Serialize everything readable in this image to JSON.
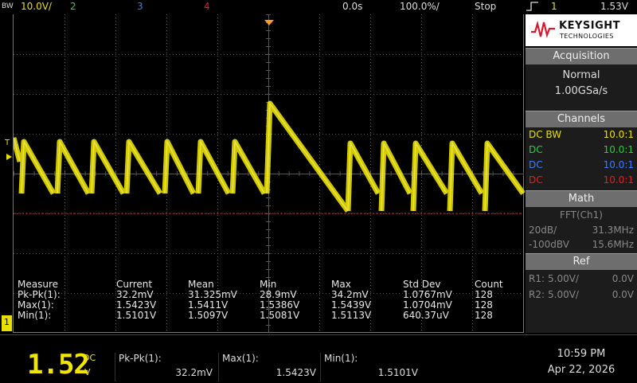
{
  "topbar": {
    "bw": "BW",
    "ch1_scale": "10.0V/",
    "ch2": "2",
    "ch3": "3",
    "ch4": "4",
    "time_offset": "0.0s",
    "time_scale": "100.0%/",
    "run_state": "Stop",
    "trig_channel": "1",
    "trig_level": "1.53V"
  },
  "scope": {
    "trigger_marker": "T",
    "channel_marker": "1"
  },
  "colors": {
    "ch1": "#e8e000",
    "ch2": "#2ecc40",
    "ch3": "#3a7bff",
    "ch4": "#e02020",
    "grid": "#555555",
    "panel_header": "#6e6e6e"
  },
  "measure": {
    "headers": [
      "Measure",
      "Current",
      "Mean",
      "Min",
      "Max",
      "Std Dev",
      "Count"
    ],
    "rows": [
      [
        "Pk-Pk(1):",
        "32.2mV",
        "31.325mV",
        "28.9mV",
        "34.2mV",
        "1.0767mV",
        "128"
      ],
      [
        "Max(1):",
        "1.5423V",
        "1.5411V",
        "1.5386V",
        "1.5439V",
        "1.0704mV",
        "128"
      ],
      [
        "Min(1):",
        "1.5101V",
        "1.5097V",
        "1.5081V",
        "1.5113V",
        "640.37uV",
        "128"
      ]
    ]
  },
  "panel": {
    "brand": "KEYSIGHT",
    "brand_sub": "TECHNOLOGIES",
    "acquisition": {
      "title": "Acquisition",
      "mode": "Normal",
      "rate": "1.00GSa/s"
    },
    "channels": {
      "title": "Channels",
      "rows": [
        {
          "label": "DC BW",
          "probe": "10.0:1"
        },
        {
          "label": "DC",
          "probe": "10.0:1"
        },
        {
          "label": "DC",
          "probe": "10.0:1"
        },
        {
          "label": "DC",
          "probe": "10.0:1"
        }
      ]
    },
    "math": {
      "title": "Math",
      "func": "FFT(Ch1)",
      "scale": "20dB/",
      "span": "31.3MHz",
      "ref_level": "-100dBV",
      "center": "15.6MHz"
    },
    "ref": {
      "title": "Ref",
      "r1_label": "R1:",
      "r1_scale": "5.00V/",
      "r1_offset": "0.0V",
      "r2_label": "R2:",
      "r2_scale": "5.00V/",
      "r2_offset": "0.0V"
    }
  },
  "bottom": {
    "big_reading": "1.52",
    "coupling": "DC",
    "unit": "V",
    "cells": [
      {
        "label": "Pk-Pk(1):",
        "value": "32.2mV"
      },
      {
        "label": "Max(1):",
        "value": "1.5423V"
      },
      {
        "label": "Min(1):",
        "value": "1.5101V"
      }
    ],
    "time": "10:59 PM",
    "date": "Apr 22, 2026"
  }
}
